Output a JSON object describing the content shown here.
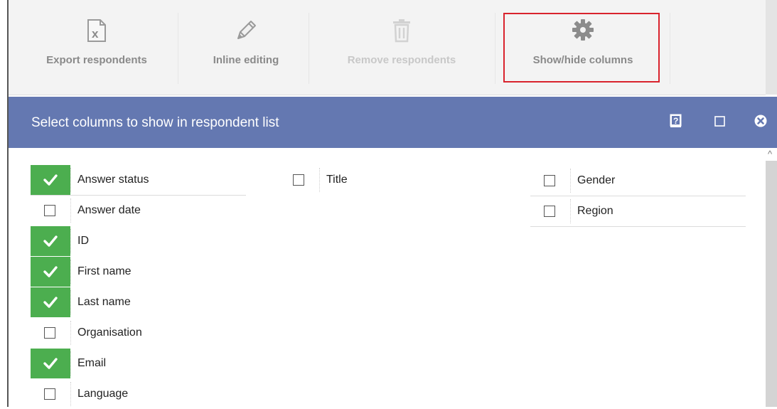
{
  "toolbar": {
    "buttons": [
      {
        "label": "Export respondents",
        "icon": "excel-export-icon",
        "enabled": true
      },
      {
        "label": "Inline editing",
        "icon": "pencil-icon",
        "enabled": true
      },
      {
        "label": "Remove respondents",
        "icon": "trash-icon",
        "enabled": false
      },
      {
        "label": "Show/hide columns",
        "icon": "gear-icon",
        "enabled": true,
        "highlighted": true
      }
    ]
  },
  "dialog": {
    "title": "Select columns to show in respondent list",
    "header_icons": [
      "help-icon",
      "maximize-icon",
      "close-icon"
    ],
    "header_color": "#6478b1"
  },
  "columns": {
    "left": [
      {
        "label": "Answer status",
        "checked": true
      },
      {
        "label": "Answer date",
        "checked": false
      },
      {
        "label": "ID",
        "checked": true
      },
      {
        "label": "First name",
        "checked": true
      },
      {
        "label": "Last name",
        "checked": true
      },
      {
        "label": "Organisation",
        "checked": false
      },
      {
        "label": "Email",
        "checked": true
      },
      {
        "label": "Language",
        "checked": false
      }
    ],
    "middle": [
      {
        "label": "Title",
        "checked": false
      }
    ],
    "right": [
      {
        "label": "Gender",
        "checked": false
      },
      {
        "label": "Region",
        "checked": false
      }
    ]
  },
  "colors": {
    "checked_bg": "#4cae4f",
    "highlight_border": "#d9232d"
  }
}
